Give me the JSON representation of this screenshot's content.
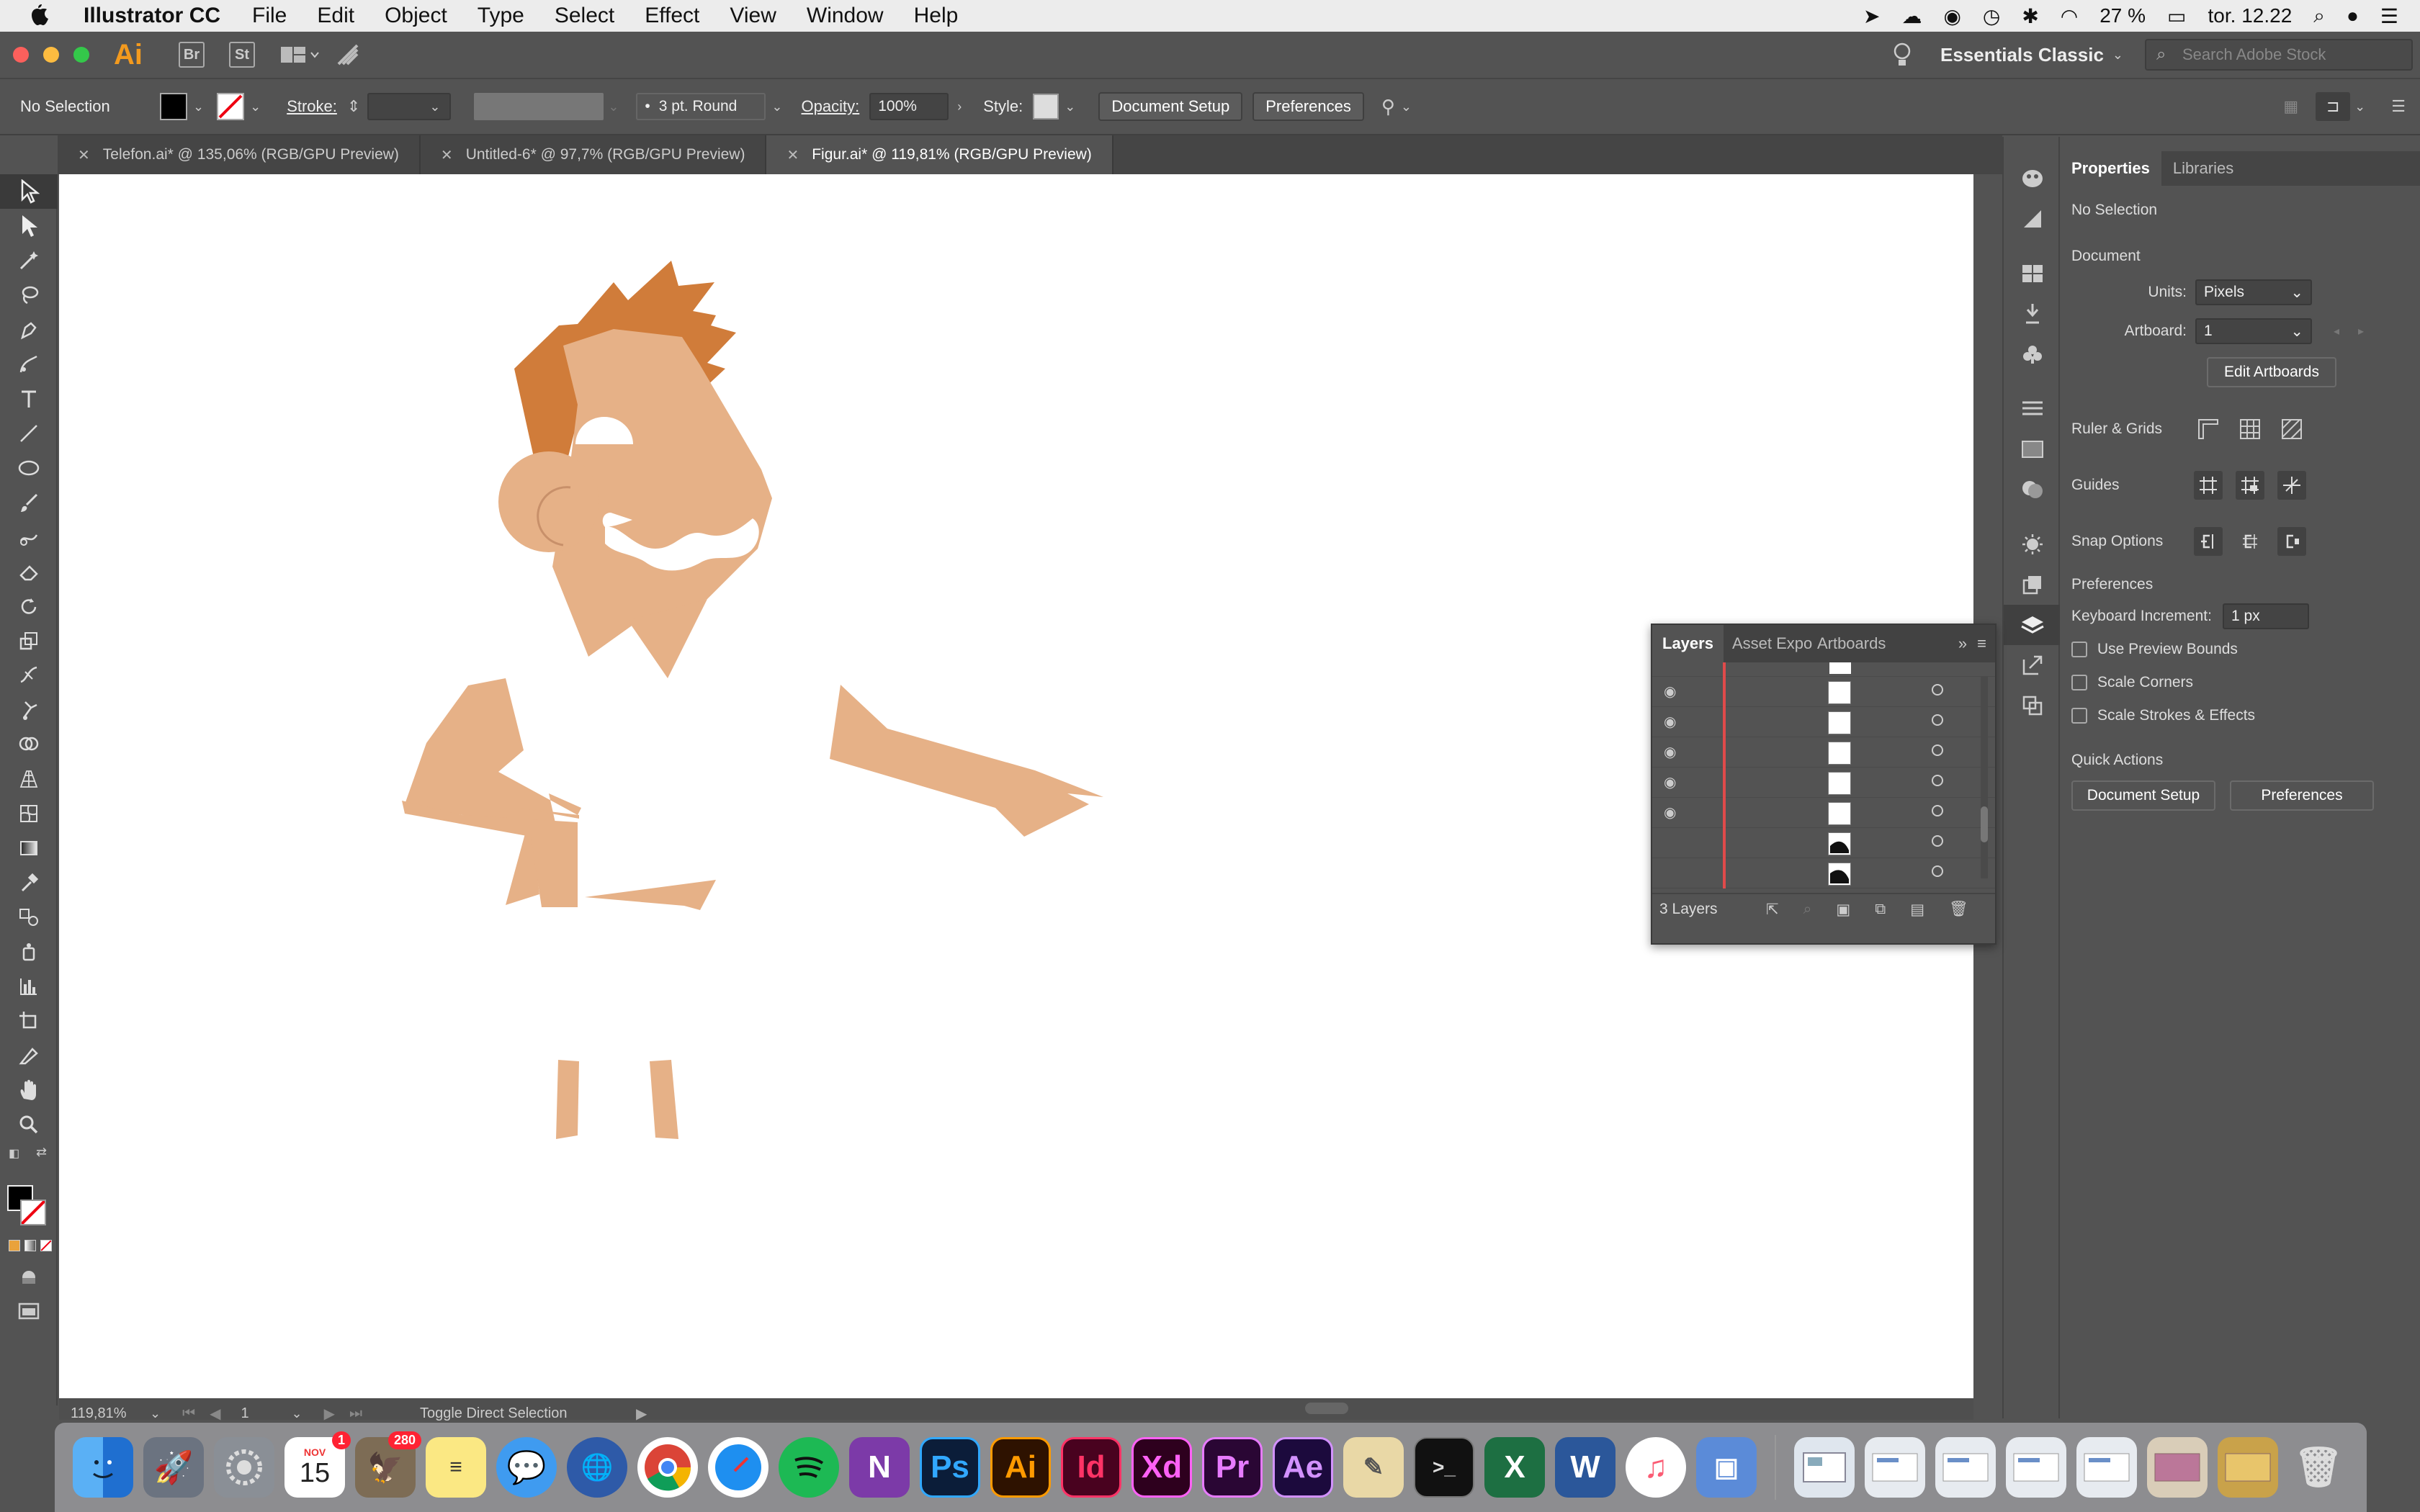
{
  "menubar": {
    "app_name": "Illustrator CC",
    "items": [
      "File",
      "Edit",
      "Object",
      "Type",
      "Select",
      "Effect",
      "View",
      "Window",
      "Help"
    ],
    "battery": "27 %",
    "clock": "tor. 12.22"
  },
  "appbar": {
    "logo": "Ai",
    "bridge": "Br",
    "stock": "St",
    "workspace": "Essentials Classic",
    "search_placeholder": "Search Adobe Stock"
  },
  "controlbar": {
    "selection": "No Selection",
    "stroke_label": "Stroke:",
    "brush": "3 pt. Round",
    "opacity_label": "Opacity:",
    "opacity_value": "100%",
    "style_label": "Style:",
    "document_setup": "Document Setup",
    "preferences": "Preferences"
  },
  "tabs": [
    {
      "label": "Telefon.ai* @ 135,06% (RGB/GPU Preview)"
    },
    {
      "label": "Untitled-6* @ 97,7% (RGB/GPU Preview)"
    },
    {
      "label": "Figur.ai* @ 119,81% (RGB/GPU Preview)"
    }
  ],
  "properties": {
    "tab_properties": "Properties",
    "tab_libraries": "Libraries",
    "no_selection": "No Selection",
    "document": "Document",
    "units_label": "Units:",
    "units_value": "Pixels",
    "artboard_label": "Artboard:",
    "artboard_value": "1",
    "edit_artboards": "Edit Artboards",
    "ruler_grids": "Ruler & Grids",
    "guides": "Guides",
    "snap_options": "Snap Options",
    "preferences_heading": "Preferences",
    "keyboard_increment_label": "Keyboard Increment:",
    "keyboard_increment_value": "1 px",
    "use_preview_bounds": "Use Preview Bounds",
    "scale_corners": "Scale Corners",
    "scale_strokes": "Scale Strokes & Effects",
    "quick_actions": "Quick Actions",
    "qa_document_setup": "Document Setup",
    "qa_preferences": "Preferences"
  },
  "layers_panel": {
    "tab_layers": "Layers",
    "tab_asset": "Asset Expo",
    "tab_artboards": "Artboards",
    "count": "3 Layers"
  },
  "statusbar": {
    "zoom": "119,81%",
    "artboard": "1",
    "tool_hint": "Toggle Direct Selection"
  },
  "dock": {
    "calendar_month": "NOV",
    "calendar_day": "15",
    "calendar_badge": "1",
    "mail_badge": "280",
    "ps": "Ps",
    "ai": "Ai",
    "id": "Id",
    "xd": "Xd",
    "pr": "Pr",
    "ae": "Ae",
    "onenote": "N",
    "excel": "X",
    "word": "W"
  },
  "colors": {
    "skin": "#e6b187",
    "hair": "#d07c3a",
    "illustrator_orange": "#f39a1e"
  }
}
